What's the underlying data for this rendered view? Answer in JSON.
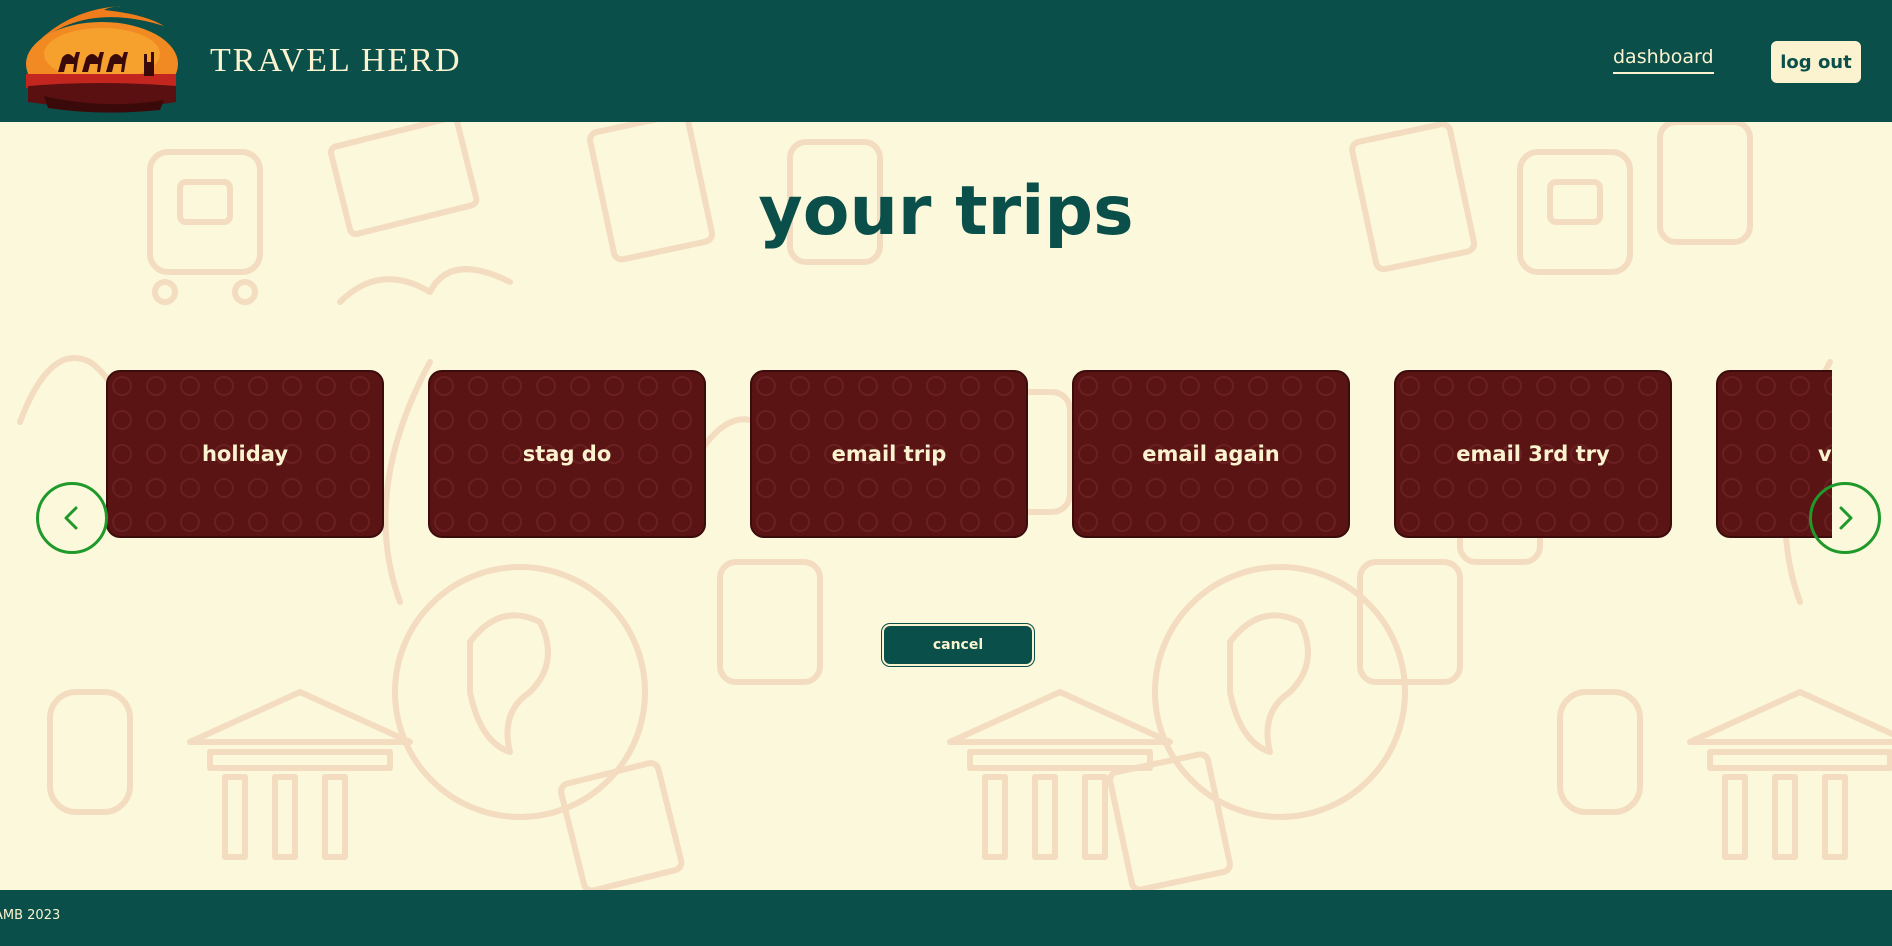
{
  "header": {
    "brand": "TRAVEL HERD",
    "logo_icon": "camel-sunset-logo",
    "nav_dashboard": "dashboard",
    "logout_label": "log out"
  },
  "main": {
    "title": "your trips",
    "trips": [
      {
        "name": "holiday"
      },
      {
        "name": "stag do"
      },
      {
        "name": "email trip"
      },
      {
        "name": "email again"
      },
      {
        "name": "email 3rd try"
      },
      {
        "name": "v"
      }
    ],
    "prev_icon": "chevron-left-icon",
    "next_icon": "chevron-right-icon",
    "cancel_label": "cancel"
  },
  "footer": {
    "text": "AMB 2023"
  },
  "colors": {
    "header_bg": "#0a4f49",
    "page_bg": "#fbf8dc",
    "card_bg": "#5a1414",
    "arrow_ring": "#1f9a2a",
    "pattern_line": "#f4dcc0"
  }
}
